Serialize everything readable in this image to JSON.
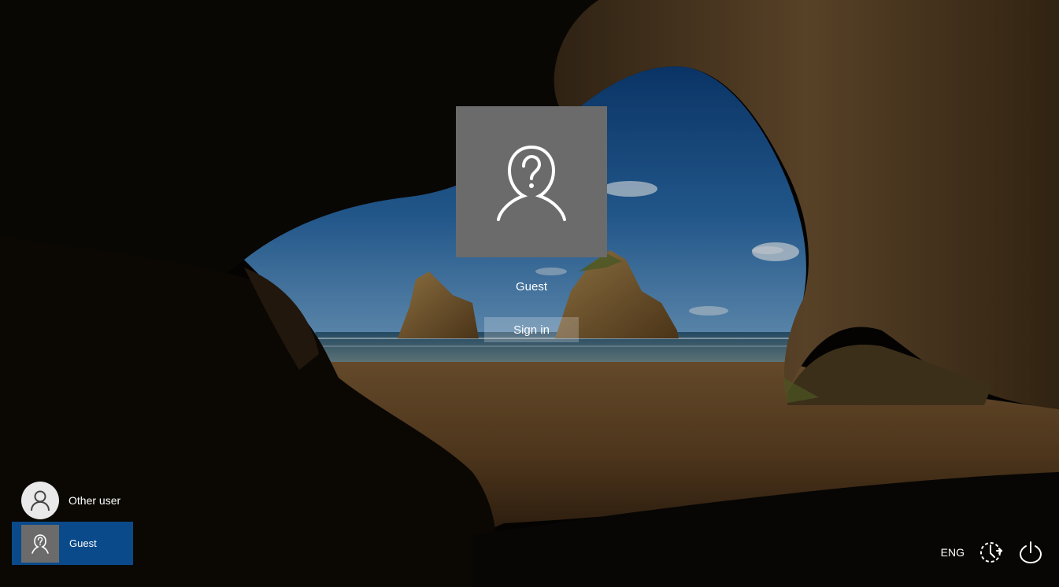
{
  "login": {
    "username": "Guest",
    "signin_label": "Sign in",
    "avatar_icon": "user-question-icon"
  },
  "users": [
    {
      "label": "Other user",
      "icon": "user-icon",
      "selected": false
    },
    {
      "label": "Guest",
      "icon": "user-question-icon",
      "selected": true
    }
  ],
  "system": {
    "language": "ENG",
    "accessibility_icon": "ease-of-access-icon",
    "power_icon": "power-icon"
  },
  "colors": {
    "avatar_bg": "#6b6b6b",
    "selected_user_bg": "#0a4a8a",
    "text": "#ffffff"
  }
}
